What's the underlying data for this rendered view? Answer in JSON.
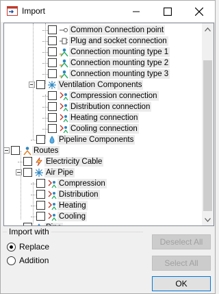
{
  "window": {
    "title": "Import"
  },
  "tree": {
    "rows": [
      {
        "label": "Common Connection point",
        "level": 3,
        "icon": "connection-point-icon"
      },
      {
        "label": "Plug and socket connection",
        "level": 3,
        "icon": "plug-socket-icon"
      },
      {
        "label": "Connection mounting type 1",
        "level": 3,
        "icon": "mounting-type-icon"
      },
      {
        "label": "Connection mounting type 2",
        "level": 3,
        "icon": "mounting-type-icon"
      },
      {
        "label": "Connection mounting type 3",
        "level": 3,
        "icon": "mounting-type-icon"
      },
      {
        "label": "Ventilation Components",
        "level": 2,
        "icon": "ventilation-icon",
        "expander": true
      },
      {
        "label": "Compression connection",
        "level": 3,
        "icon": "compression-icon"
      },
      {
        "label": "Distribution connection",
        "level": 3,
        "icon": "distribution-icon"
      },
      {
        "label": "Heating connection",
        "level": 3,
        "icon": "heating-icon"
      },
      {
        "label": "Cooling connection",
        "level": 3,
        "icon": "cooling-icon"
      },
      {
        "label": "Pipeline Components",
        "level": 2,
        "icon": "pipeline-icon"
      },
      {
        "label": "Routes",
        "level": 0,
        "icon": "routes-icon",
        "expander": true
      },
      {
        "label": "Electricity Cable",
        "level": 1,
        "icon": "electricity-cable-icon"
      },
      {
        "label": "Air Pipe",
        "level": 1,
        "icon": "air-pipe-icon",
        "expander": true
      },
      {
        "label": "Compression",
        "level": 2,
        "icon": "compression-icon"
      },
      {
        "label": "Distribution",
        "level": 2,
        "icon": "distribution-icon"
      },
      {
        "label": "Heating",
        "level": 2,
        "icon": "heating-icon"
      },
      {
        "label": "Cooling",
        "level": 2,
        "icon": "cooling-icon"
      },
      {
        "label": "Pipe",
        "level": 1,
        "icon": "pipe-icon"
      }
    ]
  },
  "import_with": {
    "legend": "Import with",
    "options": [
      {
        "label": "Replace",
        "checked": true
      },
      {
        "label": "Addition",
        "checked": false
      }
    ]
  },
  "buttons": {
    "deselect_all": "Deselect All",
    "select_all": "Select All",
    "ok": "OK"
  },
  "colors": {
    "label_bg": "#ebebeb",
    "accent": "#0078d7",
    "disabled_text": "#a0a0a0"
  }
}
